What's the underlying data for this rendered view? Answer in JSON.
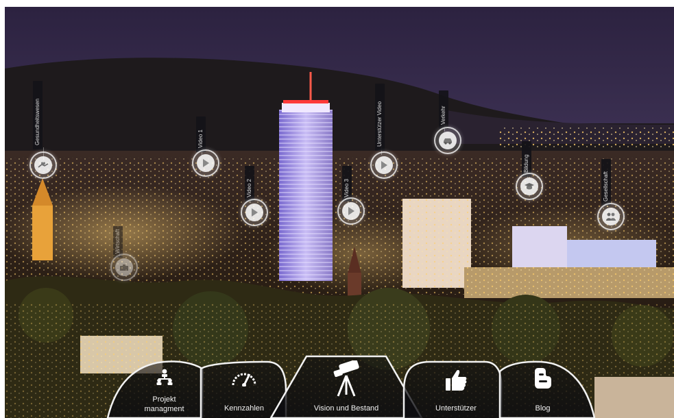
{
  "markers": [
    {
      "label": "Gesundheitswesen",
      "icon": "care-icon",
      "kind": "icon"
    },
    {
      "label": "Video 1",
      "icon": "play-icon",
      "kind": "play"
    },
    {
      "label": "Video 2",
      "icon": "play-icon",
      "kind": "play"
    },
    {
      "label": "Video 3",
      "icon": "play-icon",
      "kind": "play"
    },
    {
      "label": "Unterstützer Video",
      "icon": "play-icon",
      "kind": "play"
    },
    {
      "label": "Verkehr",
      "icon": "car-icon",
      "kind": "icon"
    },
    {
      "label": "Bildung",
      "icon": "graduation-cap-icon",
      "kind": "icon"
    },
    {
      "label": "Gesellschaft",
      "icon": "people-icon",
      "kind": "icon"
    },
    {
      "label": "Wirtschaft",
      "icon": "briefcase-icon",
      "kind": "icon"
    }
  ],
  "nav": {
    "projekt_line1": "Projekt",
    "projekt_line2": "managment",
    "kennzahlen": "Kennzahlen",
    "vision": "Vision und Bestand",
    "unterstuetzer": "Unterstützer",
    "blog": "Blog"
  },
  "colors": {
    "sky_top": "#2e2545",
    "sky_horizon": "#5a4a70",
    "city_light": "#f3b347",
    "tower_light": "#b9a8ff",
    "tower_top": "#ff3a3a"
  }
}
